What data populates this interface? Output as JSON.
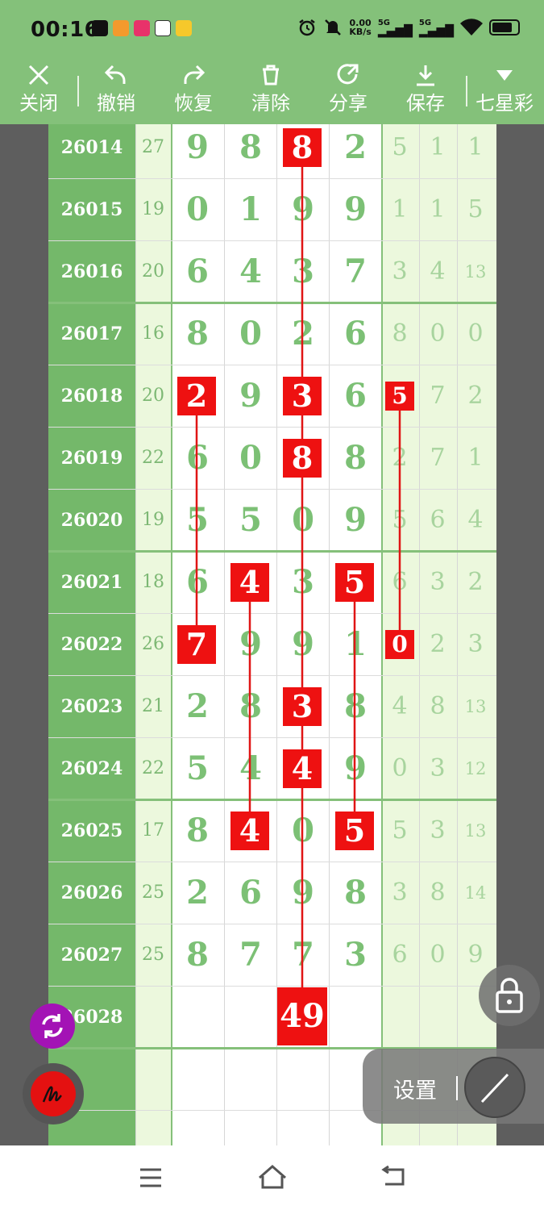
{
  "status_bar": {
    "time": "00:16",
    "net_speed_value": "0.00",
    "net_speed_unit": "KB/s",
    "sig1": "5G",
    "sig2": "5G"
  },
  "toolbar": {
    "close": "关闭",
    "undo": "撤销",
    "redo": "恢复",
    "clear": "清除",
    "share": "分享",
    "save": "保存",
    "lottery": "七星彩"
  },
  "rows": [
    {
      "issue": "26014",
      "sum": "27",
      "nums": [
        "9",
        "8",
        "8",
        "2"
      ],
      "right": [
        "5",
        "1",
        "1"
      ]
    },
    {
      "issue": "26015",
      "sum": "19",
      "nums": [
        "0",
        "1",
        "9",
        "9"
      ],
      "right": [
        "1",
        "1",
        "5"
      ]
    },
    {
      "issue": "26016",
      "sum": "20",
      "nums": [
        "6",
        "4",
        "3",
        "7"
      ],
      "right": [
        "3",
        "4",
        "13"
      ]
    },
    {
      "issue": "26017",
      "sum": "16",
      "nums": [
        "8",
        "0",
        "2",
        "6"
      ],
      "right": [
        "8",
        "0",
        "0"
      ]
    },
    {
      "issue": "26018",
      "sum": "20",
      "nums": [
        "2",
        "9",
        "3",
        "6"
      ],
      "right": [
        "5",
        "7",
        "2"
      ]
    },
    {
      "issue": "26019",
      "sum": "22",
      "nums": [
        "6",
        "0",
        "8",
        "8"
      ],
      "right": [
        "2",
        "7",
        "1"
      ]
    },
    {
      "issue": "26020",
      "sum": "19",
      "nums": [
        "5",
        "5",
        "0",
        "9"
      ],
      "right": [
        "5",
        "6",
        "4"
      ]
    },
    {
      "issue": "26021",
      "sum": "18",
      "nums": [
        "6",
        "4",
        "3",
        "5"
      ],
      "right": [
        "6",
        "3",
        "2"
      ]
    },
    {
      "issue": "26022",
      "sum": "26",
      "nums": [
        "7",
        "9",
        "9",
        "1"
      ],
      "right": [
        "0",
        "2",
        "3"
      ]
    },
    {
      "issue": "26023",
      "sum": "21",
      "nums": [
        "2",
        "8",
        "3",
        "8"
      ],
      "right": [
        "4",
        "8",
        "13"
      ]
    },
    {
      "issue": "26024",
      "sum": "22",
      "nums": [
        "5",
        "4",
        "4",
        "9"
      ],
      "right": [
        "0",
        "3",
        "12"
      ]
    },
    {
      "issue": "26025",
      "sum": "17",
      "nums": [
        "8",
        "4",
        "0",
        "5"
      ],
      "right": [
        "5",
        "3",
        "13"
      ]
    },
    {
      "issue": "26026",
      "sum": "25",
      "nums": [
        "2",
        "6",
        "9",
        "8"
      ],
      "right": [
        "3",
        "8",
        "14"
      ]
    },
    {
      "issue": "26027",
      "sum": "25",
      "nums": [
        "8",
        "7",
        "7",
        "3"
      ],
      "right": [
        "6",
        "0",
        "9"
      ]
    },
    {
      "issue": "26028",
      "sum": "",
      "nums": [
        "",
        "",
        "",
        "",
        ""
      ],
      "right": [
        "",
        "",
        ""
      ]
    }
  ],
  "highlights": [
    {
      "row": 0,
      "col": 2
    },
    {
      "row": 4,
      "col": 2
    },
    {
      "row": 5,
      "col": 2
    },
    {
      "row": 9,
      "col": 2
    },
    {
      "row": 10,
      "col": 2
    },
    {
      "row": 4,
      "col": 0
    },
    {
      "row": 8,
      "col": 0
    },
    {
      "row": 7,
      "col": 1
    },
    {
      "row": 11,
      "col": 1
    },
    {
      "row": 7,
      "col": 3
    },
    {
      "row": 11,
      "col": 3
    },
    {
      "row": 4,
      "col": 4
    },
    {
      "row": 8,
      "col": 4
    }
  ],
  "prediction": "49",
  "floating": {
    "settings_label": "设置"
  },
  "colors": {
    "green": "#84c17a",
    "dark_green": "#74b86a",
    "light_green": "#ecf8dd",
    "red": "#ee1111",
    "number_green": "#7cc075"
  }
}
